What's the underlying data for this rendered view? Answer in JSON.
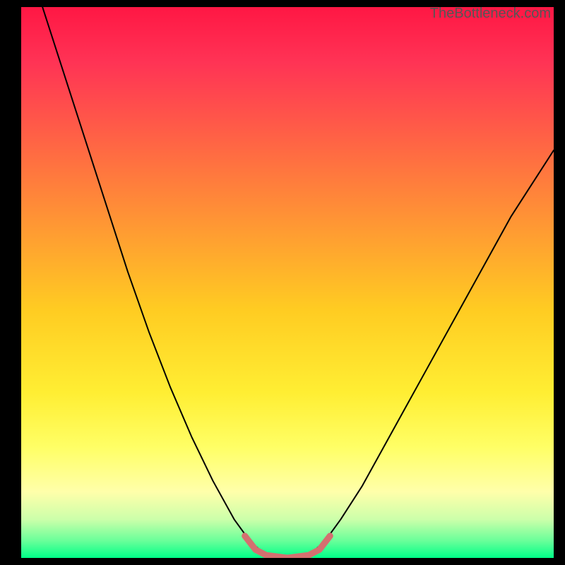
{
  "watermark": "TheBottleneck.com",
  "chart_data": {
    "type": "line",
    "title": "",
    "xlabel": "",
    "ylabel": "",
    "xlim": [
      0,
      100
    ],
    "ylim": [
      0,
      100
    ],
    "background": {
      "type": "vertical-gradient",
      "stops": [
        {
          "pos": 0.0,
          "color": "#ff1744"
        },
        {
          "pos": 0.1,
          "color": "#ff3355"
        },
        {
          "pos": 0.25,
          "color": "#ff6644"
        },
        {
          "pos": 0.4,
          "color": "#ff9933"
        },
        {
          "pos": 0.55,
          "color": "#ffcc22"
        },
        {
          "pos": 0.7,
          "color": "#ffee33"
        },
        {
          "pos": 0.8,
          "color": "#ffff66"
        },
        {
          "pos": 0.88,
          "color": "#ffffaa"
        },
        {
          "pos": 0.93,
          "color": "#ccffaa"
        },
        {
          "pos": 0.97,
          "color": "#66ff99"
        },
        {
          "pos": 1.0,
          "color": "#00ff88"
        }
      ]
    },
    "series": [
      {
        "name": "curve",
        "color": "#000000",
        "width": 2,
        "points": [
          {
            "x": 4,
            "y": 100
          },
          {
            "x": 8,
            "y": 88
          },
          {
            "x": 12,
            "y": 76
          },
          {
            "x": 16,
            "y": 64
          },
          {
            "x": 20,
            "y": 52
          },
          {
            "x": 24,
            "y": 41
          },
          {
            "x": 28,
            "y": 31
          },
          {
            "x": 32,
            "y": 22
          },
          {
            "x": 36,
            "y": 14
          },
          {
            "x": 40,
            "y": 7
          },
          {
            "x": 43,
            "y": 3
          },
          {
            "x": 46,
            "y": 0.5
          },
          {
            "x": 50,
            "y": 0
          },
          {
            "x": 54,
            "y": 0.5
          },
          {
            "x": 57,
            "y": 3
          },
          {
            "x": 60,
            "y": 7
          },
          {
            "x": 64,
            "y": 13
          },
          {
            "x": 68,
            "y": 20
          },
          {
            "x": 72,
            "y": 27
          },
          {
            "x": 76,
            "y": 34
          },
          {
            "x": 80,
            "y": 41
          },
          {
            "x": 84,
            "y": 48
          },
          {
            "x": 88,
            "y": 55
          },
          {
            "x": 92,
            "y": 62
          },
          {
            "x": 96,
            "y": 68
          },
          {
            "x": 100,
            "y": 74
          }
        ]
      },
      {
        "name": "highlight",
        "color": "#d47070",
        "width": 9,
        "points": [
          {
            "x": 42,
            "y": 4
          },
          {
            "x": 44,
            "y": 1.5
          },
          {
            "x": 46,
            "y": 0.5
          },
          {
            "x": 50,
            "y": 0
          },
          {
            "x": 54,
            "y": 0.5
          },
          {
            "x": 56,
            "y": 1.5
          },
          {
            "x": 58,
            "y": 4
          }
        ]
      }
    ]
  }
}
